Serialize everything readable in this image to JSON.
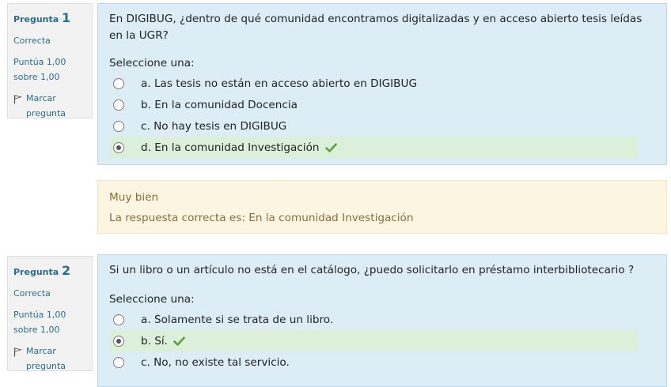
{
  "questions": [
    {
      "label": "Pregunta",
      "number": "1",
      "status": "Correcta",
      "score_line1": "Puntúa 1,00",
      "score_line2": "sobre 1,00",
      "flag_line1": "Marcar",
      "flag_line2": "pregunta",
      "text": "En DIGIBUG, ¿dentro de qué comunidad encontramos digitalizadas y en acceso abierto tesis leídas en la UGR?",
      "prompt": "Seleccione una:",
      "answers": [
        {
          "text": "a. Las tesis no están en acceso abierto en DIGIBUG",
          "selected": false,
          "correct": false
        },
        {
          "text": "b. En la comunidad Docencia",
          "selected": false,
          "correct": false
        },
        {
          "text": "c. No hay tesis en DIGIBUG",
          "selected": false,
          "correct": false
        },
        {
          "text": "d. En la comunidad Investigación",
          "selected": true,
          "correct": true
        }
      ]
    },
    {
      "label": "Pregunta",
      "number": "2",
      "status": "Correcta",
      "score_line1": "Puntúa 1,00",
      "score_line2": "sobre 1,00",
      "flag_line1": "Marcar",
      "flag_line2": "pregunta",
      "text": "Si un libro o un artículo no está en el catálogo, ¿puedo solicitarlo en préstamo interbibliotecario ?",
      "prompt": "Seleccione una:",
      "answers": [
        {
          "text": "a. Solamente si se trata de un libro.",
          "selected": false,
          "correct": false
        },
        {
          "text": "b. Sí.",
          "selected": true,
          "correct": true
        },
        {
          "text": "c. No, no existe tal servicio.",
          "selected": false,
          "correct": false
        }
      ]
    }
  ],
  "feedback": {
    "general": "Muy bien",
    "right_answer": "La respuesta correcta es: En la comunidad Investigación"
  },
  "colors": {
    "info_link": "#2a6d8a",
    "content_bg": "#dcedf6",
    "correct_bg": "#dcf0d9",
    "check": "#5c9c45",
    "feedback_bg": "#fcf5e1",
    "feedback_text": "#8a6d3b"
  }
}
